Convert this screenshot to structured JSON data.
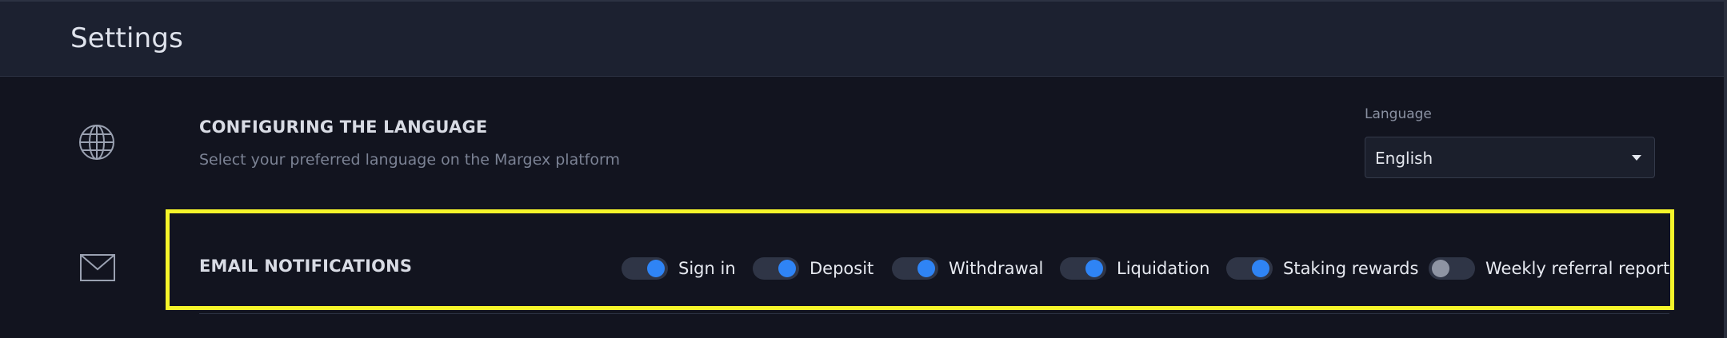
{
  "header": {
    "title": "Settings"
  },
  "language_section": {
    "icon": "globe-icon",
    "title": "CONFIGURING THE LANGUAGE",
    "description": "Select your preferred language on the Margex platform",
    "field_label": "Language",
    "selected_value": "English"
  },
  "email_section": {
    "icon": "envelope-icon",
    "title": "EMAIL NOTIFICATIONS",
    "highlight_color": "#f5f52a",
    "toggles": [
      {
        "label": "Sign in",
        "enabled": true
      },
      {
        "label": "Deposit",
        "enabled": true
      },
      {
        "label": "Withdrawal",
        "enabled": true
      },
      {
        "label": "Liquidation",
        "enabled": true
      },
      {
        "label": "Staking rewards",
        "enabled": true
      },
      {
        "label": "Weekly referral report",
        "enabled": false
      }
    ]
  },
  "colors": {
    "accent": "#2f84f5",
    "background": "#12141f",
    "header_background": "#1c2130"
  }
}
